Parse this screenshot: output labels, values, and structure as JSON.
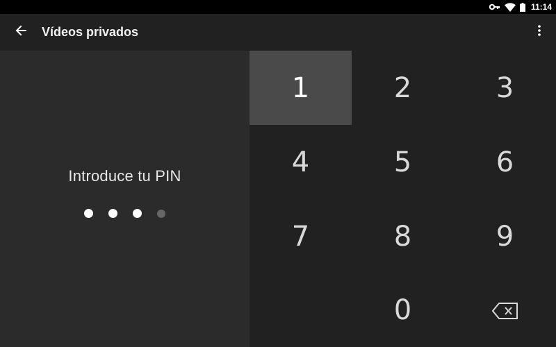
{
  "status_bar": {
    "time": "11:14",
    "icons": [
      "key-icon",
      "wifi-icon",
      "battery-icon"
    ]
  },
  "app_bar": {
    "title": "Vídeos privados",
    "back_icon": "arrow-back-icon",
    "overflow_icon": "more-vert-icon"
  },
  "pin_panel": {
    "prompt": "Introduce tu PIN",
    "digits_entered": 3,
    "digits_total": 4
  },
  "keypad": {
    "keys": [
      "1",
      "2",
      "3",
      "4",
      "5",
      "6",
      "7",
      "8",
      "9",
      "0"
    ],
    "pressed_key": "1",
    "delete_icon": "backspace-icon"
  },
  "colors": {
    "status_bar_bg": "#000000",
    "app_bar_bg": "#212122",
    "left_panel_bg": "#2b2b2c",
    "keypad_bg": "#212122",
    "pressed_key_bg": "#4a4a4b",
    "dot_filled": "#ffffff",
    "dot_empty": "#666667"
  }
}
